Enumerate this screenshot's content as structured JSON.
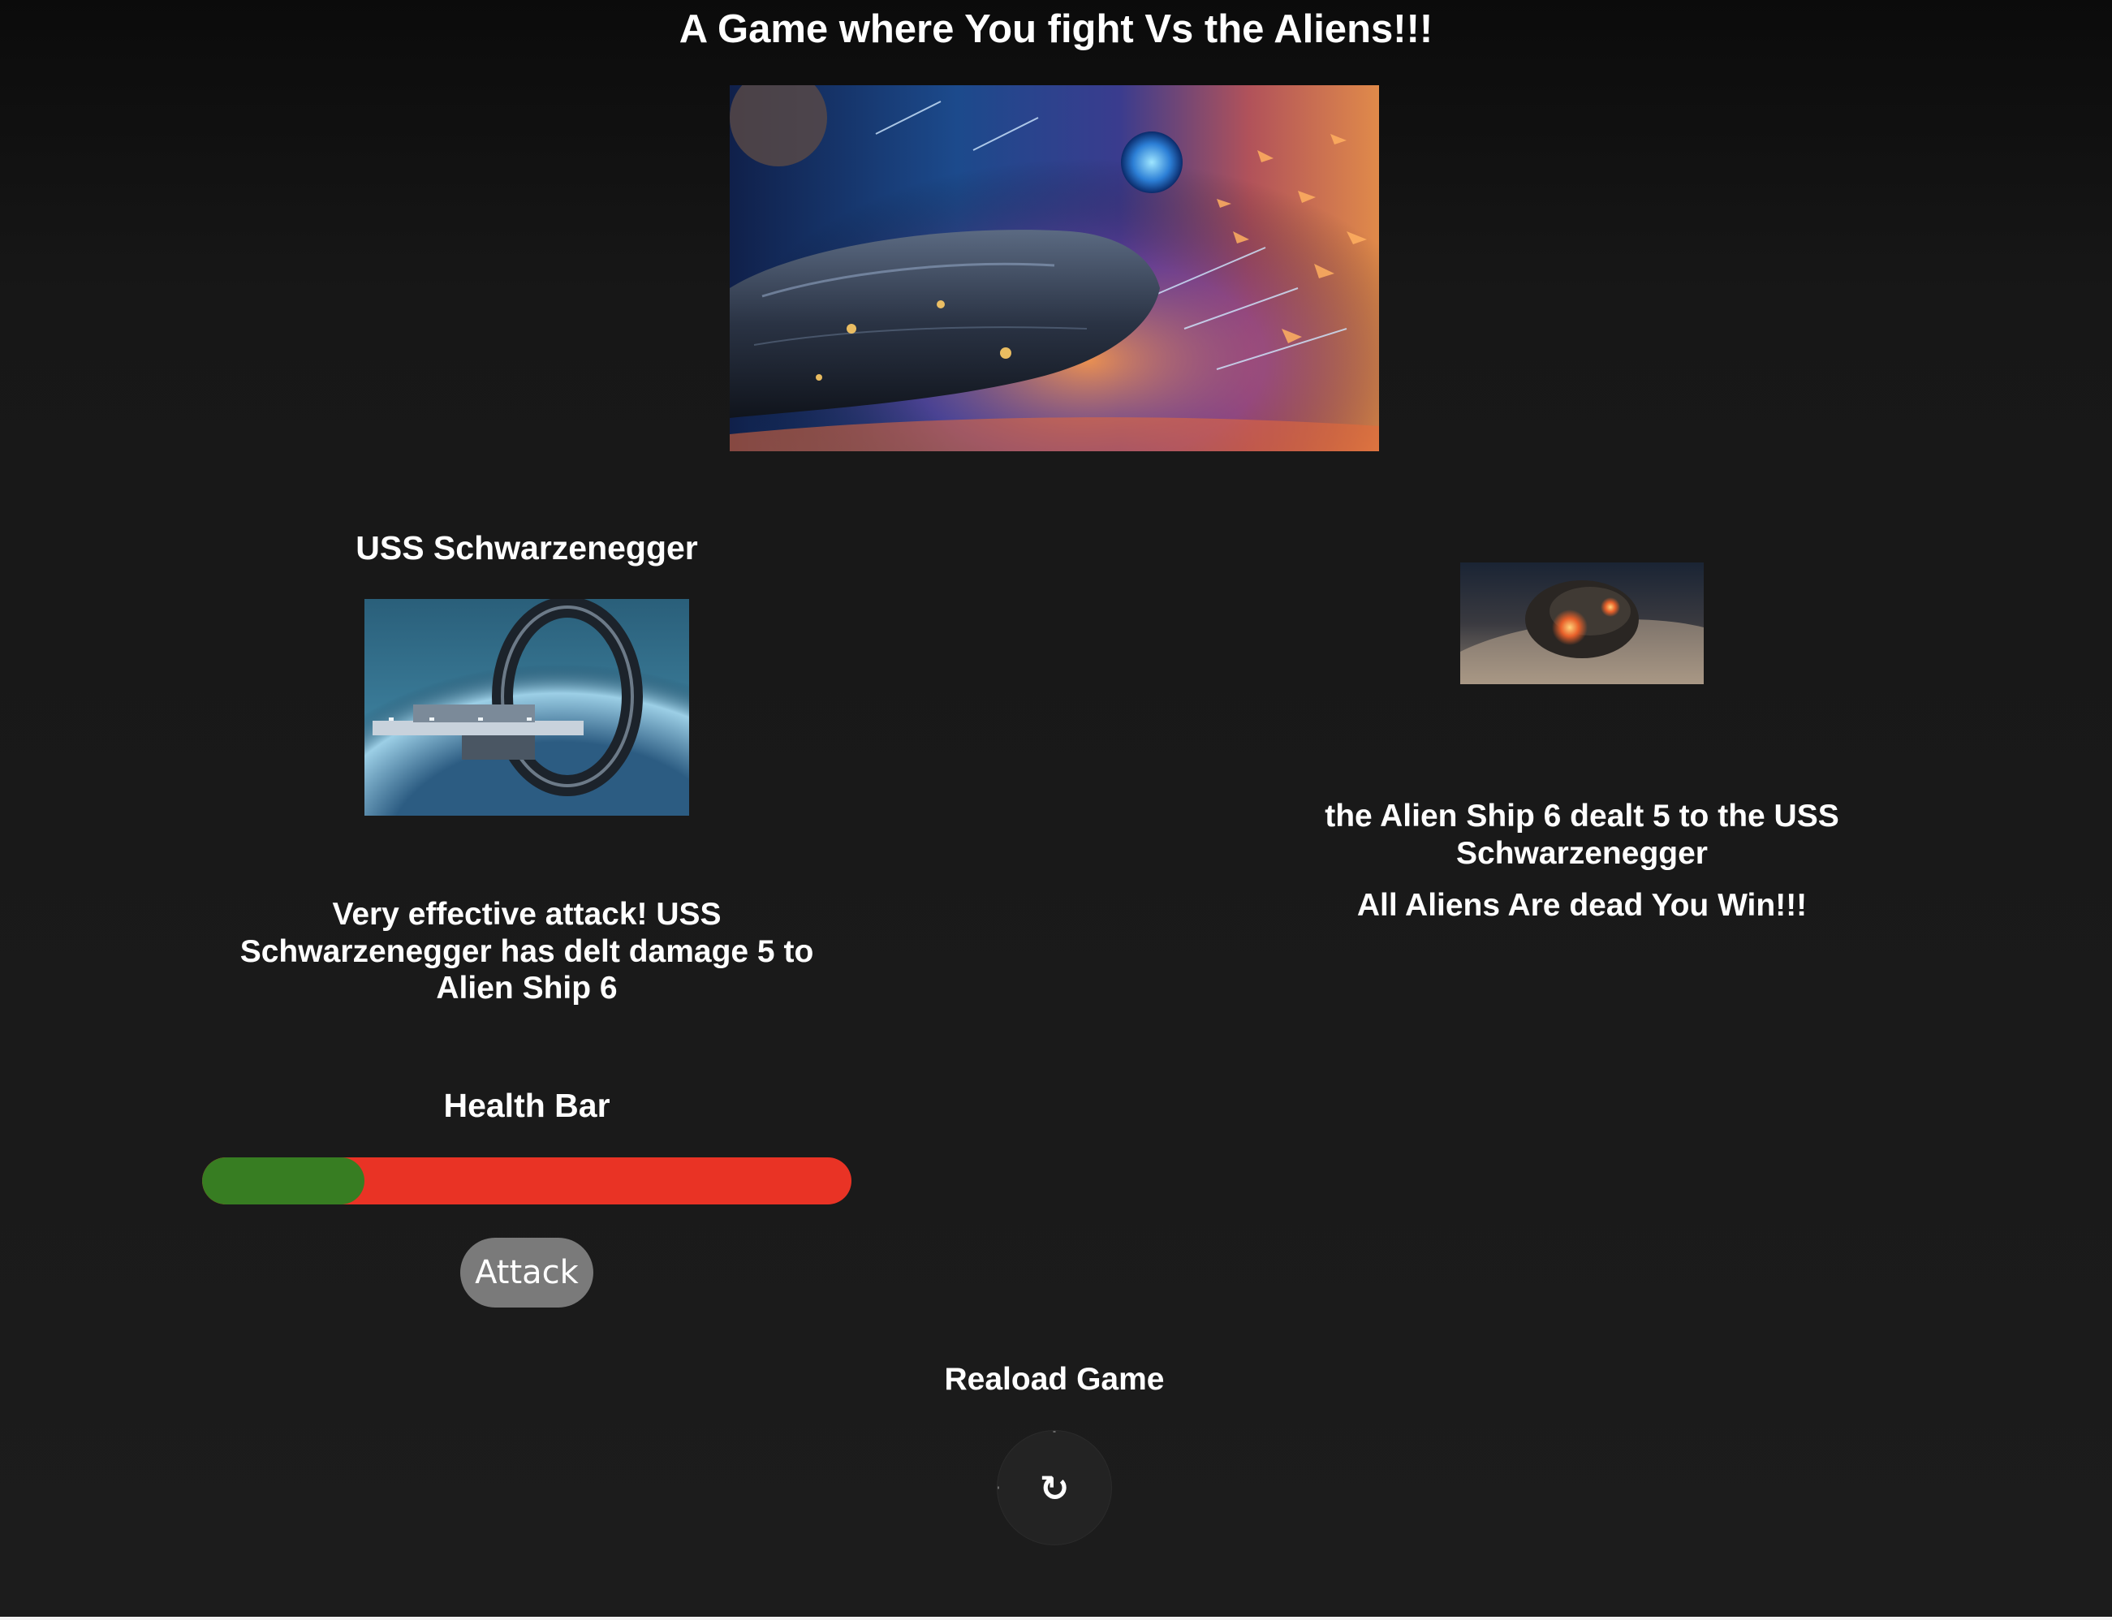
{
  "header": {
    "title": "A Game where You fight Vs the Aliens!!!"
  },
  "player": {
    "name": "USS Schwarzenegger",
    "message": "Very effective attack! USS Schwarzenegger has delt damage 5 to Alien Ship 6",
    "health_label": "Health Bar",
    "health_fraction": 0.25,
    "attack_label": "Attack"
  },
  "alien": {
    "message": "the Alien Ship 6 dealt 5 to the USS Schwarzenegger",
    "result": "All Aliens Are dead You Win!!!"
  },
  "reload": {
    "label": "Reaload Game",
    "icon": "reload-icon"
  },
  "colors": {
    "background": "#1c1c1c",
    "health_remaining": "#377d22",
    "health_lost": "#e93325",
    "attack_button": "#7a7a7a",
    "text": "#ffffff"
  }
}
